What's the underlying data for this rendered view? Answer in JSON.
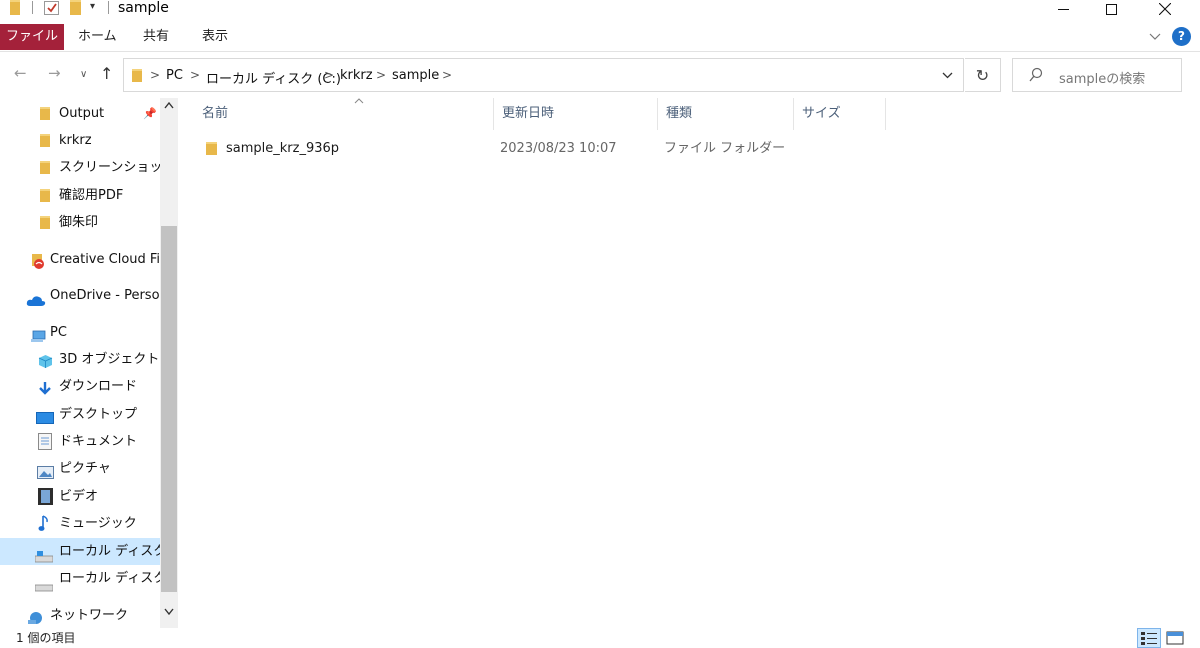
{
  "window": {
    "title": "sample"
  },
  "ribbon": {
    "tabs": [
      "ファイル",
      "ホーム",
      "共有",
      "表示"
    ],
    "help_label": "?"
  },
  "address": {
    "breadcrumb": [
      "PC",
      "ローカル ディスク (C:)",
      "krkrz",
      "sample"
    ]
  },
  "search": {
    "placeholder": "sampleの検索"
  },
  "nav_pane": {
    "quick_access": [
      {
        "label": "Output",
        "icon": "folder-icon",
        "pinned": true
      },
      {
        "label": "krkrz",
        "icon": "folder-icon"
      },
      {
        "label": "スクリーンショット",
        "icon": "folder-icon"
      },
      {
        "label": "確認用PDF",
        "icon": "folder-icon"
      },
      {
        "label": "御朱印",
        "icon": "folder-icon"
      }
    ],
    "creative_cloud": "Creative Cloud Files",
    "onedrive": "OneDrive - Personal",
    "pc": "PC",
    "pc_items": [
      {
        "label": "3D オブジェクト",
        "icon": "3d-objects-icon"
      },
      {
        "label": "ダウンロード",
        "icon": "download-icon"
      },
      {
        "label": "デスクトップ",
        "icon": "desktop-icon"
      },
      {
        "label": "ドキュメント",
        "icon": "document-icon"
      },
      {
        "label": "ピクチャ",
        "icon": "pictures-icon"
      },
      {
        "label": "ビデオ",
        "icon": "video-icon"
      },
      {
        "label": "ミュージック",
        "icon": "music-icon"
      },
      {
        "label": "ローカル ディスク (C:)",
        "icon": "drive-icon",
        "selected": true
      },
      {
        "label": "ローカル ディスク (D:)",
        "icon": "drive-icon"
      }
    ],
    "network": "ネットワーク"
  },
  "content": {
    "columns": [
      "名前",
      "更新日時",
      "種類",
      "サイズ"
    ],
    "rows": [
      {
        "name": "sample_krz_936p",
        "modified": "2023/08/23 10:07",
        "type": "ファイル フォルダー",
        "size": ""
      }
    ]
  },
  "status": {
    "item_count": "1 個の項目"
  },
  "colors": {
    "file_tab": "#a4213a",
    "selection": "#cce8ff",
    "folder": "#e8b84a"
  }
}
